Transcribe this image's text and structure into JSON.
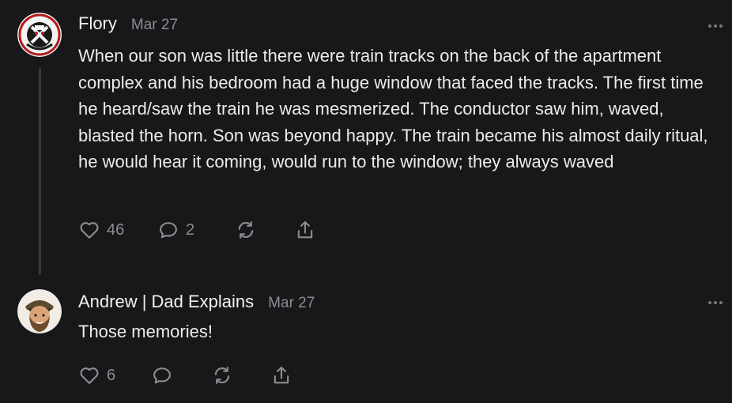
{
  "comments": [
    {
      "author": "Flory",
      "date": "Mar 27",
      "avatar_icon": "skull-emblem-avatar",
      "text": "When our son was little there were train tracks on the back of the apartment complex and his bedroom had a huge window that faced the tracks. The first time he heard/saw the train he was mesmerized. The conductor saw him, waved, blasted the horn. Son was beyond happy. The train became his almost daily ritual, he would hear it coming, would run to the window; they always waved",
      "likes": "46",
      "replies": "2",
      "more_icon": "more-options-icon"
    },
    {
      "author": "Andrew | Dad Explains",
      "date": "Mar 27",
      "avatar_icon": "bearded-man-avatar",
      "text": "Those memories!",
      "likes": "6",
      "replies": "",
      "more_icon": "more-options-icon"
    }
  ],
  "icons": [
    "heart-icon",
    "comment-icon",
    "restack-icon",
    "share-icon",
    "more-options-icon"
  ],
  "colors": {
    "background": "#18181a",
    "text": "#ececec",
    "muted": "#8d8d92",
    "thread_line": "#3a3a3d"
  }
}
